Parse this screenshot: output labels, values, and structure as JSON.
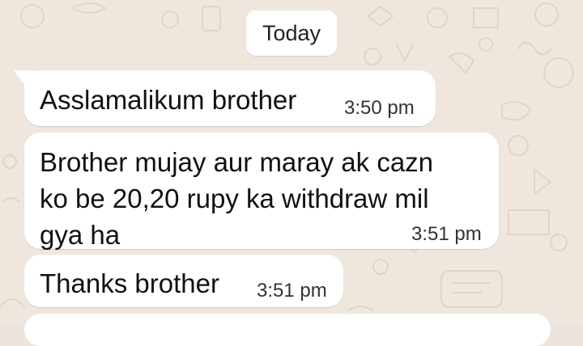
{
  "date_chip": "Today",
  "messages": [
    {
      "text": "Asslamalikum brother",
      "time": "3:50 pm"
    },
    {
      "text": "Brother mujay aur maray ak cazn\nko be 20,20 rupy ka withdraw mil\ngya ha",
      "time": "3:51 pm"
    },
    {
      "text": "Thanks brother",
      "time": "3:51 pm"
    }
  ],
  "colors": {
    "wallpaper": "#efe7de",
    "bubble": "#ffffff",
    "text": "#111111"
  }
}
